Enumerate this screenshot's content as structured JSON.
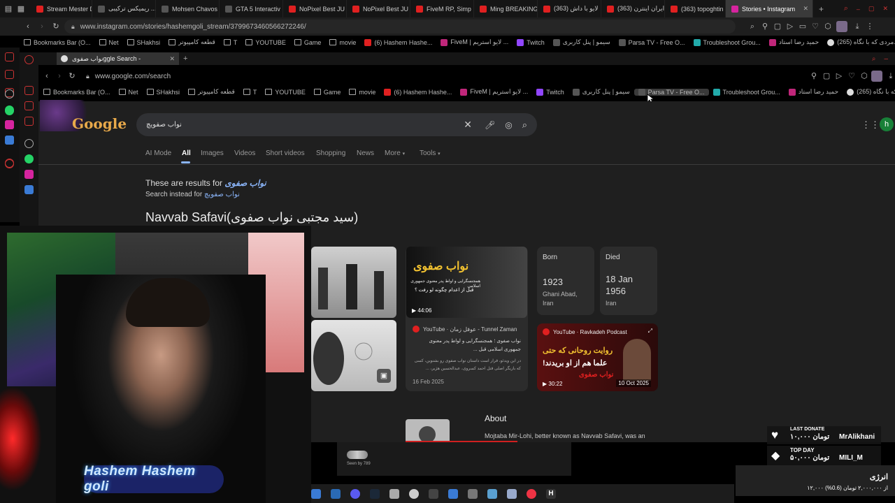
{
  "outer_browser": {
    "tabs": [
      "Stream Mester D",
      "ریمیکس ترکیبی ...",
      "Mohsen Chavos",
      "GTA 5 Interactiv",
      "NoPixel Best JU",
      "NoPixel Best JU",
      "FiveM RP, Simp",
      "Ming BREAKING",
      "(363) لایو با داش",
      "(363) ایران اینترن",
      "(363) topoghtin",
      "Stories • Instagram"
    ],
    "address": "www.instagram.com/stories/hashemgoli_stream/3799673460566272246/",
    "bookmarks": [
      "Bookmarks Bar (O...",
      "Net",
      "SHakhsi",
      "قطعه کامپیوتر",
      "T",
      "YOUTUBE",
      "Game",
      "movie",
      "(6) Hashem Hashe...",
      "FiveM | لایو استریم ...",
      "Twitch",
      "سیمو | پنل کاربری",
      "Parsa TV - Free O...",
      "Troubleshoot Grou...",
      "حمید رضا استاد",
      "(265) مردی که با نگاه..."
    ]
  },
  "inner_browser": {
    "tab_label": "نواب صفویggle Search - ",
    "address": "www.google.com/search",
    "bookmarks": [
      "Bookmarks Bar (O...",
      "Net",
      "SHakhsi",
      "قطعه کامپیوتر",
      "T",
      "YOUTUBE",
      "Game",
      "movie",
      "(6) Hashem Hashe...",
      "FiveM | لایو استریم ...",
      "Twitch",
      "سیمو | پنل کاربری",
      "Parsa TV - Free O...",
      "Troubleshoot Grou...",
      "حمید رضا استاد",
      "(265) مردی که با نگاه..."
    ]
  },
  "google": {
    "logo": "Google",
    "query": "نواب صفویچ",
    "avatar": "h",
    "filters": [
      "AI Mode",
      "All",
      "Images",
      "Videos",
      "Short videos",
      "Shopping",
      "News",
      "More",
      "Tools"
    ],
    "results_for_prefix": "These are results for",
    "results_for_term": "نواب صفوی",
    "search_instead_prefix": "Search instead for",
    "search_instead_term": "نواب صفویچ",
    "entity_title": "Navvab Safavi(سید مجتبی نواب صفوی)",
    "born": {
      "label": "Born",
      "year": "1923",
      "place1": "Ghani Abad,",
      "place2": "Iran"
    },
    "died": {
      "label": "Died",
      "date1": "18 Jan",
      "date2": "1956",
      "place": "Iran"
    },
    "video1": {
      "overlay_title": "نواب صفوی",
      "overlay_sub": "همجنسگرایی و اواط پدر معنوی جمهوری اسلامی",
      "overlay_sub2": "قبل از اعدام چگونه لو رفت ؟",
      "duration": "44:06",
      "channel": "YouTube · عوفل زمان - Tunnel Zaman",
      "desc1": "نواب صفوی ؛ همجنسگرایی و لواط پدر معنوی",
      "desc2": "جمهوری اسلامی قبل ...",
      "desc3": "در این ویدئو، قرار است داستان نواب صفوی رو بشنوین، کسی",
      "desc4": "که بازیگر اصلی قتل احمد کسروی، عبدالحسین هژیر، ...",
      "date": "16 Feb 2025"
    },
    "video2": {
      "channel": "YouTube · Ravkadeh Podcast",
      "overlay1": "روایت روحانی که حتی",
      "overlay2": "علما هم از او بریدند!",
      "overlay3": "نواب صفوی",
      "duration": "30:22",
      "date": "10 Oct 2025"
    },
    "about_title": "About",
    "about_text": "Mojtaba Mir-Lohi, better known as Navvab Safavi, was an",
    "seen_by": "Seen by 789"
  },
  "stream": {
    "name": "Hashem Hashem goli",
    "last_donate_label": "LAST DONATE",
    "last_donate_amount": "۱۰,۰۰۰ تومان",
    "last_donate_user": "MrAlikhani",
    "top_day_label": "TOP DAY",
    "top_day_amount": "۵۰,۰۰۰ تومان",
    "top_day_user": "MILI_M",
    "energy_title": "انرژی",
    "energy_progress": "۱۲,۰۰۰ از ۲,۰۰۰,۰۰۰ تومان (0.6%)"
  },
  "colors": {
    "accent": "#8ab4f8",
    "instagram": "#d6249f",
    "youtube": "#e02020",
    "donate": "#ffffff"
  }
}
